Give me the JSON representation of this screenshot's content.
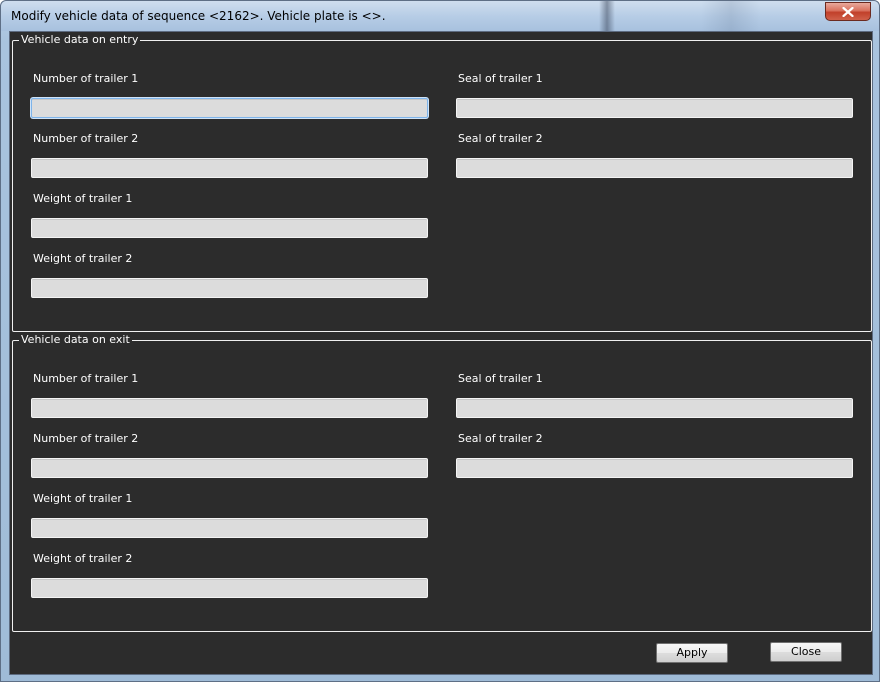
{
  "window": {
    "title": "Modify vehicle data of sequence <2162>. Vehicle plate is <>.",
    "close_glyph": "✕"
  },
  "entry": {
    "legend": "Vehicle data on entry",
    "fields": {
      "number_trailer_1": {
        "label": "Number of trailer 1",
        "value": ""
      },
      "seal_trailer_1": {
        "label": "Seal of trailer 1",
        "value": ""
      },
      "number_trailer_2": {
        "label": "Number of trailer 2",
        "value": ""
      },
      "seal_trailer_2": {
        "label": "Seal of trailer 2",
        "value": ""
      },
      "weight_trailer_1": {
        "label": "Weight of trailer 1",
        "value": ""
      },
      "weight_trailer_2": {
        "label": "Weight of trailer 2",
        "value": ""
      }
    }
  },
  "exit": {
    "legend": "Vehicle data on exit",
    "fields": {
      "number_trailer_1": {
        "label": "Number of trailer 1",
        "value": ""
      },
      "seal_trailer_1": {
        "label": "Seal of trailer 1",
        "value": ""
      },
      "number_trailer_2": {
        "label": "Number of trailer 2",
        "value": ""
      },
      "seal_trailer_2": {
        "label": "Seal of trailer 2",
        "value": ""
      },
      "weight_trailer_1": {
        "label": "Weight of trailer 1",
        "value": ""
      },
      "weight_trailer_2": {
        "label": "Weight of trailer 2",
        "value": ""
      }
    }
  },
  "buttons": {
    "apply": "Apply",
    "close": "Close"
  },
  "colors": {
    "client_background": "#2c2c2c",
    "input_background": "#dcdcdc",
    "text": "#ffffff",
    "title_close_button": "#c1402a"
  }
}
